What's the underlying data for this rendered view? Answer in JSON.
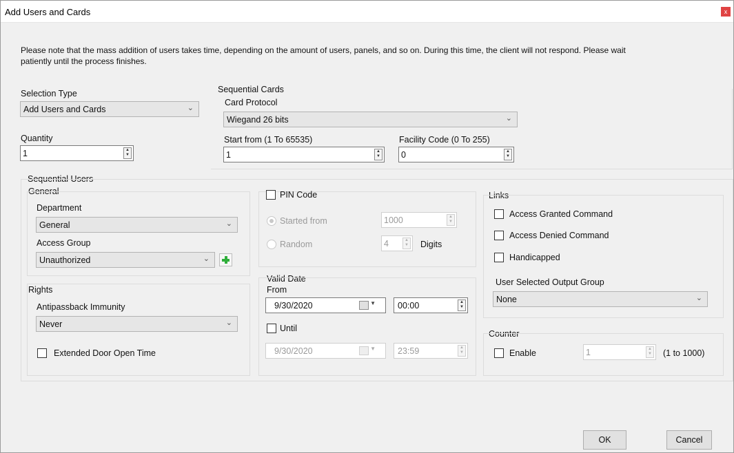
{
  "window": {
    "title": "Add Users and Cards",
    "close_label": "x"
  },
  "note": "Please note that the mass addition of users takes time, depending on the amount of users, panels, and so on. During this time, the client will not respond. Please wait patiently until the process finishes.",
  "selection": {
    "label": "Selection Type",
    "value": "Add Users and Cards"
  },
  "quantity": {
    "label": "Quantity",
    "value": "1"
  },
  "sequential_cards": {
    "title": "Sequential Cards",
    "protocol_label": "Card Protocol",
    "protocol_value": "Wiegand 26 bits",
    "start_label": "Start from (1 To 65535)",
    "start_value": "1",
    "facility_label": "Facility Code (0 To 255)",
    "facility_value": "0"
  },
  "sequential_users": {
    "title": "Sequential Users",
    "general": {
      "title": "General",
      "department_label": "Department",
      "department_value": "General",
      "access_group_label": "Access Group",
      "access_group_value": "Unauthorized"
    },
    "rights": {
      "title": "Rights",
      "antipassback_label": "Antipassback Immunity",
      "antipassback_value": "Never",
      "extended_label": "Extended Door Open Time"
    },
    "pin": {
      "label": "PIN Code",
      "started_label": "Started from",
      "started_value": "1000",
      "random_label": "Random",
      "digits_value": "4",
      "digits_label": "Digits"
    },
    "valid_date": {
      "title": "Valid Date",
      "from_label": "From",
      "from_date": "9/30/2020",
      "from_time": "00:00",
      "until_label": "Until",
      "until_date": "9/30/2020",
      "until_time": "23:59"
    },
    "links": {
      "title": "Links",
      "granted_label": "Access Granted Command",
      "denied_label": "Access Denied Command",
      "handicapped_label": "Handicapped",
      "output_label": "User Selected Output Group",
      "output_value": "None"
    },
    "counter": {
      "title": "Counter",
      "enable_label": "Enable",
      "value": "1",
      "range_label": "(1 to 1000)"
    }
  },
  "buttons": {
    "ok": "OK",
    "cancel": "Cancel"
  }
}
